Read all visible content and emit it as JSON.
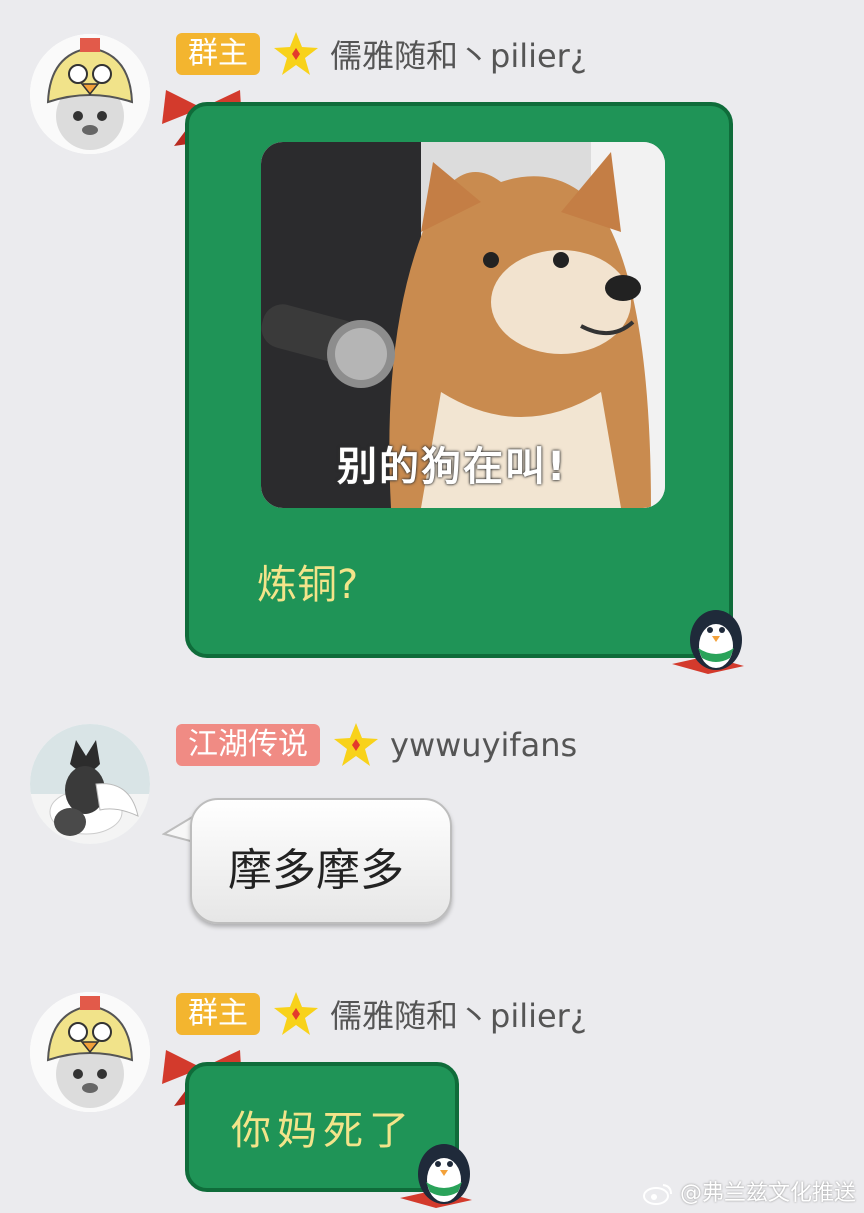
{
  "messages": [
    {
      "badge": "群主",
      "badge_color": "#f3b52f",
      "nickname": "儒雅随和丶pilier¿",
      "image_caption": "别的狗在叫!",
      "text": "炼铜?"
    },
    {
      "badge": "江湖传说",
      "badge_color": "#f08b84",
      "nickname": "ywwuyifans",
      "text": "摩多摩多"
    },
    {
      "badge": "群主",
      "badge_color": "#f3b52f",
      "nickname": "儒雅随和丶pilier¿",
      "text": "你妈死了"
    }
  ],
  "watermark": "@弗兰兹文化推送"
}
